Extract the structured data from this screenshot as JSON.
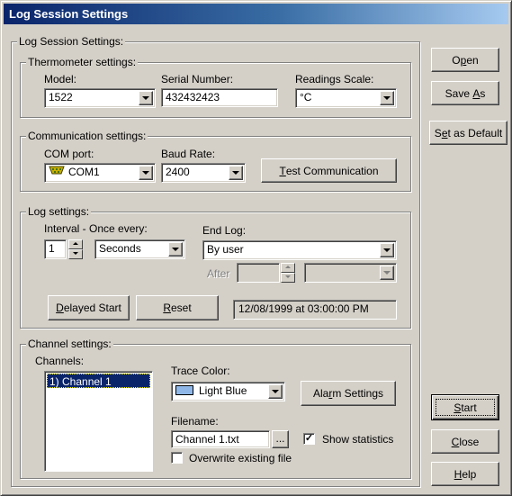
{
  "window": {
    "title": "Log Session Settings"
  },
  "main_group": {
    "legend": "Log Session Settings:"
  },
  "thermometer": {
    "legend": "Thermometer settings:",
    "model_label": "Model:",
    "model_value": "1522",
    "serial_label": "Serial Number:",
    "serial_value": "432432423",
    "scale_label": "Readings Scale:",
    "scale_value": "°C"
  },
  "communication": {
    "legend": "Communication settings:",
    "port_label": "COM port:",
    "port_value": "COM1",
    "port_icon": "serial-port-icon",
    "baud_label": "Baud Rate:",
    "baud_value": "2400",
    "test_button": {
      "mnemonic": "T",
      "rest": "est Communication"
    }
  },
  "log": {
    "legend": "Log settings:",
    "interval_label": "Interval - Once every:",
    "interval_value": "1",
    "interval_unit": "Seconds",
    "end_label": "End Log:",
    "end_value": "By user",
    "after_label": "After",
    "after_value": "",
    "after_unit": "",
    "delayed_button": {
      "mnemonic": "D",
      "rest": "elayed Start"
    },
    "reset_button": {
      "mnemonic": "R",
      "rest": "eset"
    },
    "start_time": "12/08/1999 at 03:00:00 PM"
  },
  "channel": {
    "legend": "Channel settings:",
    "channels_label": "Channels:",
    "channels": [
      "1) Channel 1"
    ],
    "trace_label": "Trace Color:",
    "trace_value": "Light Blue",
    "trace_color": "#8fb8e8",
    "alarm_button": {
      "pre": "Ala",
      "mnemonic": "r",
      "rest": "m Settings"
    },
    "filename_label": "Filename:",
    "filename_value": "Channel 1.txt",
    "browse_label": "...",
    "show_stats_label": "Show statistics",
    "show_stats_checked": true,
    "overwrite_label": "Overwrite existing file",
    "overwrite_checked": false
  },
  "side_buttons": {
    "open": {
      "pre": "O",
      "mnemonic": "p",
      "rest": "en"
    },
    "save_as": {
      "pre": "Save ",
      "mnemonic": "A",
      "rest": "s"
    },
    "set_default": {
      "pre": "S",
      "mnemonic": "e",
      "rest": "t as Default"
    },
    "start": {
      "mnemonic": "S",
      "rest": "tart"
    },
    "close": {
      "mnemonic": "C",
      "rest": "lose"
    },
    "help": {
      "mnemonic": "H",
      "rest": "elp"
    }
  },
  "colors": {
    "face": "#d4d0c8",
    "title_start": "#0a246a",
    "title_end": "#a6caf0",
    "selection": "#0a246a"
  }
}
